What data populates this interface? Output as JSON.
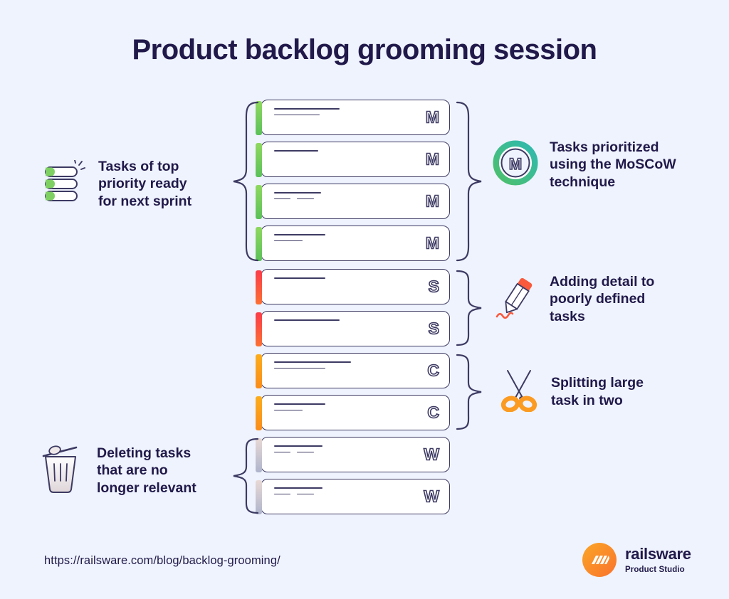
{
  "page": {
    "title": "Product backlog grooming session",
    "background_color": "#eff3fd",
    "text_color": "#20194a"
  },
  "cards": [
    {
      "letter": "M",
      "accent": "green",
      "accent_color": "#6ecb5c",
      "lines": [
        [
          92,
          0
        ],
        [
          64,
          0
        ]
      ]
    },
    {
      "letter": "M",
      "accent": "green",
      "accent_color": "#6ecb5c",
      "lines": [
        [
          62,
          0
        ]
      ]
    },
    {
      "letter": "M",
      "accent": "green",
      "accent_color": "#6ecb5c",
      "lines": [
        [
          66,
          0
        ],
        [
          23,
          24
        ]
      ]
    },
    {
      "letter": "M",
      "accent": "green",
      "accent_color": "#6ecb5c",
      "lines": [
        [
          72,
          0
        ],
        [
          40,
          0
        ]
      ]
    },
    {
      "letter": "S",
      "accent": "red",
      "accent_color": "#fb4b3f",
      "lines": [
        [
          72,
          0
        ]
      ]
    },
    {
      "letter": "S",
      "accent": "red",
      "accent_color": "#fb4b3f",
      "lines": [
        [
          92,
          0
        ]
      ]
    },
    {
      "letter": "C",
      "accent": "orange",
      "accent_color": "#fa961b",
      "lines": [
        [
          108,
          0
        ],
        [
          72,
          0
        ]
      ]
    },
    {
      "letter": "C",
      "accent": "orange",
      "accent_color": "#fa961b",
      "lines": [
        [
          72,
          0
        ],
        [
          40,
          0
        ]
      ]
    },
    {
      "letter": "W",
      "accent": "grey",
      "accent_color": "#b4b8cd",
      "lines": [
        [
          68,
          0
        ],
        [
          23,
          24
        ]
      ]
    },
    {
      "letter": "W",
      "accent": "grey",
      "accent_color": "#b4b8cd",
      "lines": [
        [
          68,
          0
        ],
        [
          23,
          24
        ]
      ]
    }
  ],
  "annotations": {
    "top_priority": {
      "icon": "stacked-list-icon",
      "text": "Tasks of top\npriority ready\nfor next sprint"
    },
    "moscow": {
      "icon": "moscow-badge-icon",
      "badge_letter": "M",
      "text": "Tasks prioritized\nusing the MoSCoW\ntechnique"
    },
    "adding_detail": {
      "icon": "pencil-icon",
      "text": "Adding detail to\npoorly defined\ntasks"
    },
    "splitting": {
      "icon": "scissors-icon",
      "text": "Splitting  large\ntask in two"
    },
    "deleting": {
      "icon": "trash-icon",
      "text": "Deleting tasks\nthat are no\nlonger relevant"
    }
  },
  "footer": {
    "url": "https://railsware.com/blog/backlog-grooming/",
    "logo_name": "railsware",
    "logo_tagline": "Product Studio",
    "logo_color": "#f9822a"
  }
}
